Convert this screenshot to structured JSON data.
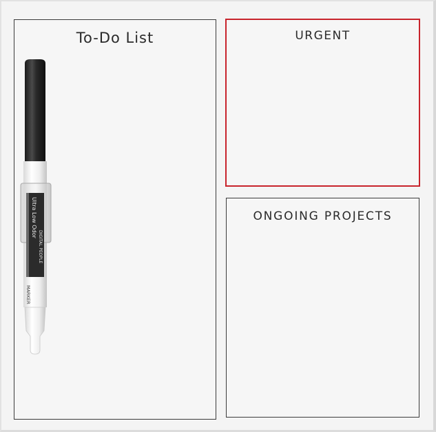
{
  "board": {
    "todo": {
      "title": "To-Do List"
    },
    "urgent": {
      "title": "URGENT"
    },
    "ongoing": {
      "title": "ONGOING PROJECTS"
    }
  },
  "marker": {
    "brand": "Ultra Low Odor",
    "maker": "DIGITAL PEOPLE",
    "type": "MARKER"
  },
  "colors": {
    "urgent_accent": "#c8232b",
    "frame": "#3a3a3a",
    "board": "#f4f4f4"
  }
}
